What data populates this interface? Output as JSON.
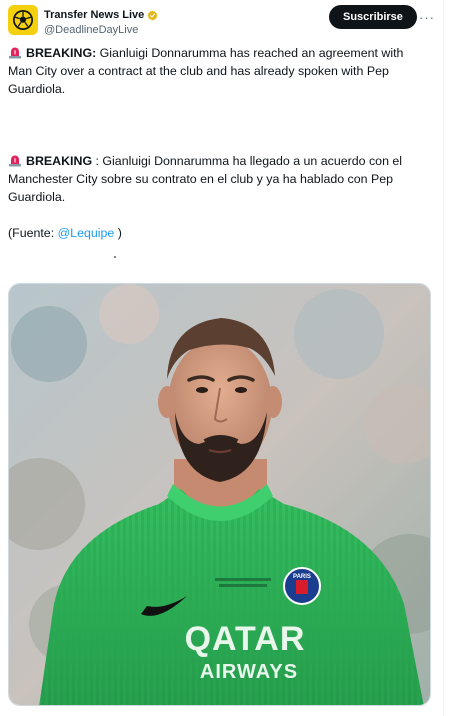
{
  "account": {
    "display_name": "Transfer News Live",
    "handle": "@DeadlineDayLive",
    "verified": true
  },
  "actions": {
    "subscribe_label": "Suscribirse",
    "more_label": "···"
  },
  "tweet": {
    "para1_label": "BREAKING:",
    "para1_text": " Gianluigi Donnarumma has reached an agreement with Man City over a contract at the club and has already spoken with Pep Guardiola.",
    "para2_label": "BREAKING",
    "para2_text": " : Gianluigi Donnarumma ha llegado a un acuerdo con el Manchester City sobre su contrato en el club y ya ha hablado con Pep Guardiola.",
    "source_prefix": "(Fuente: ",
    "source_mention": "@Lequipe",
    "source_suffix": " )"
  },
  "media": {
    "jersey_sponsor_top": "QATAR",
    "jersey_sponsor_bottom": "AIRWAYS",
    "crest_text": "PARIS",
    "jersey_color": "#2fb55a",
    "background_color": "#b9c4c8"
  },
  "colors": {
    "accent": "#1d9bf0",
    "avatar_bg": "#f5d00f",
    "siren": "#e0245e"
  }
}
